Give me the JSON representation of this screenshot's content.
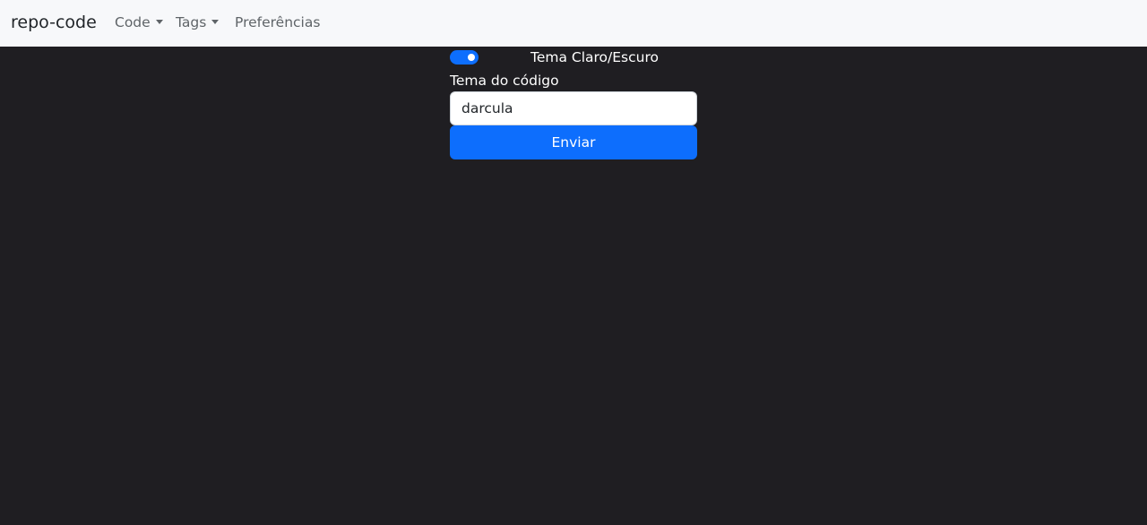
{
  "navbar": {
    "brand": "repo-code",
    "items": [
      {
        "label": "Code",
        "dropdown": true
      },
      {
        "label": "Tags",
        "dropdown": true
      },
      {
        "label": "Preferências",
        "dropdown": false
      }
    ]
  },
  "form": {
    "theme_toggle": {
      "label": "Tema Claro/Escuro",
      "checked": true
    },
    "code_theme": {
      "label": "Tema do código",
      "value": "darcula"
    },
    "submit_label": "Enviar"
  },
  "colors": {
    "accent": "#0d6efd",
    "page_background": "#1f1e22",
    "navbar_background": "#f7f8fa"
  }
}
